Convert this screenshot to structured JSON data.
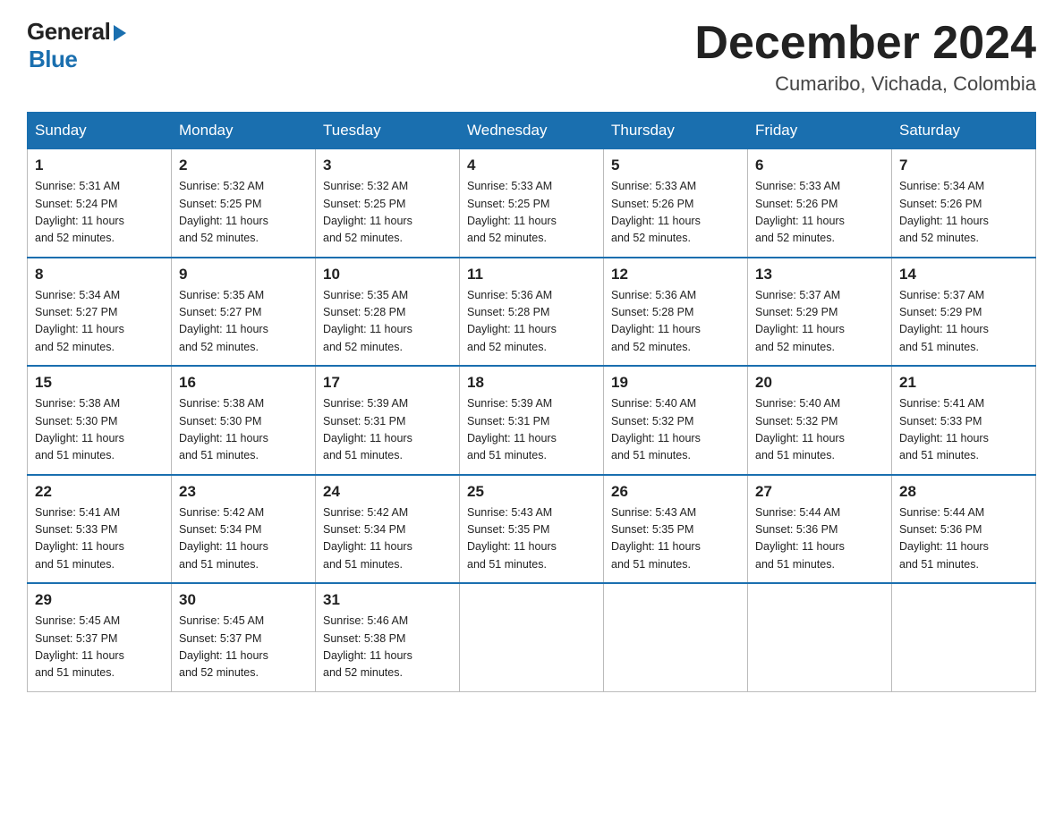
{
  "header": {
    "logo_general": "General",
    "logo_blue": "Blue",
    "month_title": "December 2024",
    "location": "Cumaribo, Vichada, Colombia"
  },
  "days_of_week": [
    "Sunday",
    "Monday",
    "Tuesday",
    "Wednesday",
    "Thursday",
    "Friday",
    "Saturday"
  ],
  "weeks": [
    [
      {
        "day": "1",
        "sunrise": "5:31 AM",
        "sunset": "5:24 PM",
        "daylight": "11 hours and 52 minutes."
      },
      {
        "day": "2",
        "sunrise": "5:32 AM",
        "sunset": "5:25 PM",
        "daylight": "11 hours and 52 minutes."
      },
      {
        "day": "3",
        "sunrise": "5:32 AM",
        "sunset": "5:25 PM",
        "daylight": "11 hours and 52 minutes."
      },
      {
        "day": "4",
        "sunrise": "5:33 AM",
        "sunset": "5:25 PM",
        "daylight": "11 hours and 52 minutes."
      },
      {
        "day": "5",
        "sunrise": "5:33 AM",
        "sunset": "5:26 PM",
        "daylight": "11 hours and 52 minutes."
      },
      {
        "day": "6",
        "sunrise": "5:33 AM",
        "sunset": "5:26 PM",
        "daylight": "11 hours and 52 minutes."
      },
      {
        "day": "7",
        "sunrise": "5:34 AM",
        "sunset": "5:26 PM",
        "daylight": "11 hours and 52 minutes."
      }
    ],
    [
      {
        "day": "8",
        "sunrise": "5:34 AM",
        "sunset": "5:27 PM",
        "daylight": "11 hours and 52 minutes."
      },
      {
        "day": "9",
        "sunrise": "5:35 AM",
        "sunset": "5:27 PM",
        "daylight": "11 hours and 52 minutes."
      },
      {
        "day": "10",
        "sunrise": "5:35 AM",
        "sunset": "5:28 PM",
        "daylight": "11 hours and 52 minutes."
      },
      {
        "day": "11",
        "sunrise": "5:36 AM",
        "sunset": "5:28 PM",
        "daylight": "11 hours and 52 minutes."
      },
      {
        "day": "12",
        "sunrise": "5:36 AM",
        "sunset": "5:28 PM",
        "daylight": "11 hours and 52 minutes."
      },
      {
        "day": "13",
        "sunrise": "5:37 AM",
        "sunset": "5:29 PM",
        "daylight": "11 hours and 52 minutes."
      },
      {
        "day": "14",
        "sunrise": "5:37 AM",
        "sunset": "5:29 PM",
        "daylight": "11 hours and 51 minutes."
      }
    ],
    [
      {
        "day": "15",
        "sunrise": "5:38 AM",
        "sunset": "5:30 PM",
        "daylight": "11 hours and 51 minutes."
      },
      {
        "day": "16",
        "sunrise": "5:38 AM",
        "sunset": "5:30 PM",
        "daylight": "11 hours and 51 minutes."
      },
      {
        "day": "17",
        "sunrise": "5:39 AM",
        "sunset": "5:31 PM",
        "daylight": "11 hours and 51 minutes."
      },
      {
        "day": "18",
        "sunrise": "5:39 AM",
        "sunset": "5:31 PM",
        "daylight": "11 hours and 51 minutes."
      },
      {
        "day": "19",
        "sunrise": "5:40 AM",
        "sunset": "5:32 PM",
        "daylight": "11 hours and 51 minutes."
      },
      {
        "day": "20",
        "sunrise": "5:40 AM",
        "sunset": "5:32 PM",
        "daylight": "11 hours and 51 minutes."
      },
      {
        "day": "21",
        "sunrise": "5:41 AM",
        "sunset": "5:33 PM",
        "daylight": "11 hours and 51 minutes."
      }
    ],
    [
      {
        "day": "22",
        "sunrise": "5:41 AM",
        "sunset": "5:33 PM",
        "daylight": "11 hours and 51 minutes."
      },
      {
        "day": "23",
        "sunrise": "5:42 AM",
        "sunset": "5:34 PM",
        "daylight": "11 hours and 51 minutes."
      },
      {
        "day": "24",
        "sunrise": "5:42 AM",
        "sunset": "5:34 PM",
        "daylight": "11 hours and 51 minutes."
      },
      {
        "day": "25",
        "sunrise": "5:43 AM",
        "sunset": "5:35 PM",
        "daylight": "11 hours and 51 minutes."
      },
      {
        "day": "26",
        "sunrise": "5:43 AM",
        "sunset": "5:35 PM",
        "daylight": "11 hours and 51 minutes."
      },
      {
        "day": "27",
        "sunrise": "5:44 AM",
        "sunset": "5:36 PM",
        "daylight": "11 hours and 51 minutes."
      },
      {
        "day": "28",
        "sunrise": "5:44 AM",
        "sunset": "5:36 PM",
        "daylight": "11 hours and 51 minutes."
      }
    ],
    [
      {
        "day": "29",
        "sunrise": "5:45 AM",
        "sunset": "5:37 PM",
        "daylight": "11 hours and 51 minutes."
      },
      {
        "day": "30",
        "sunrise": "5:45 AM",
        "sunset": "5:37 PM",
        "daylight": "11 hours and 52 minutes."
      },
      {
        "day": "31",
        "sunrise": "5:46 AM",
        "sunset": "5:38 PM",
        "daylight": "11 hours and 52 minutes."
      },
      null,
      null,
      null,
      null
    ]
  ],
  "labels": {
    "sunrise": "Sunrise:",
    "sunset": "Sunset:",
    "daylight": "Daylight:"
  }
}
